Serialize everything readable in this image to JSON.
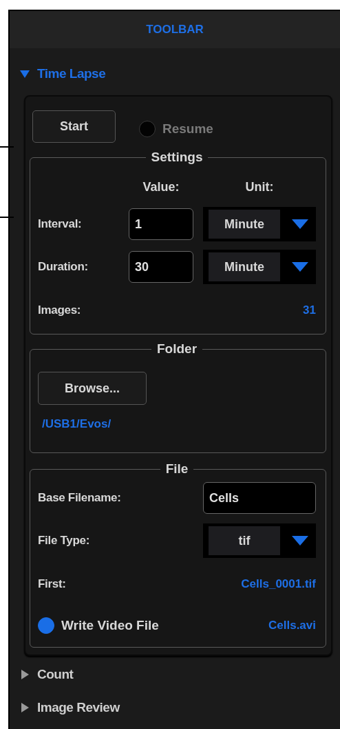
{
  "toolbar": {
    "title": "TOOLBAR"
  },
  "sections": [
    {
      "title": "Time Lapse",
      "expanded": true
    },
    {
      "title": "Count",
      "expanded": false
    },
    {
      "title": "Image Review",
      "expanded": false
    }
  ],
  "time_lapse": {
    "start_button": "Start",
    "resume": {
      "label": "Resume",
      "selected": false
    },
    "settings": {
      "legend": "Settings",
      "value_header": "Value:",
      "unit_header": "Unit:",
      "rows": [
        {
          "label": "Interval:",
          "value": "1",
          "unit": "Minute"
        },
        {
          "label": "Duration:",
          "value": "30",
          "unit": "Minute"
        }
      ],
      "images_label": "Images:",
      "images_value": "31"
    },
    "folder": {
      "legend": "Folder",
      "browse_button": "Browse...",
      "path": "/USB1/Evos/"
    },
    "file": {
      "legend": "File",
      "base_label": "Base Filename:",
      "base_value": "Cells",
      "type_label": "File Type:",
      "type_value": "tif",
      "first_label": "First:",
      "first_value": "Cells_0001.tif",
      "video": {
        "label": "Write Video File",
        "checked": true
      },
      "video_name": "Cells.avi"
    }
  }
}
